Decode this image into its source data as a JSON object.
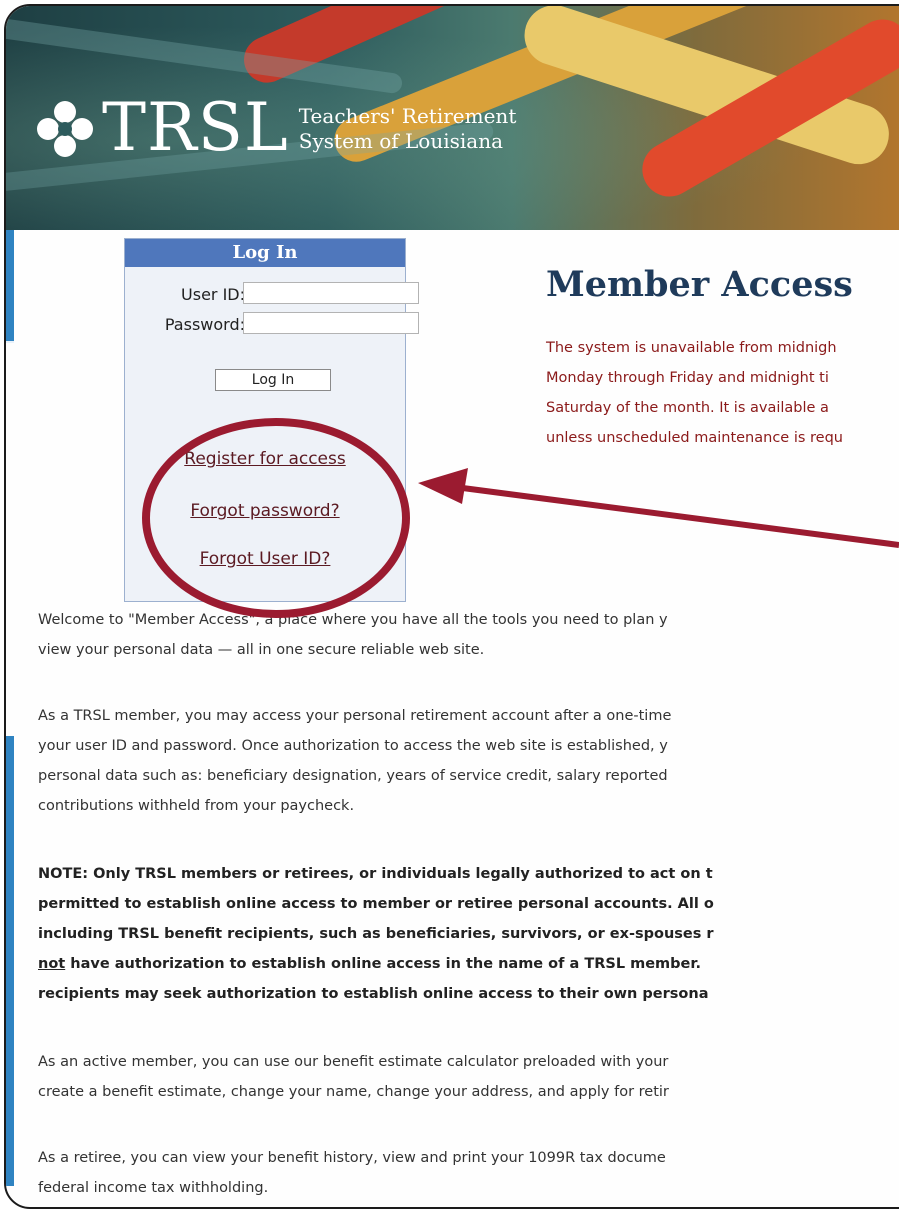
{
  "header": {
    "logo_text": "TRSL",
    "org_line1": "Teachers' Retirement",
    "org_line2": "System of Louisiana"
  },
  "login": {
    "title": "Log In",
    "user_id_label": "User ID:",
    "user_id_value": "",
    "password_label": "Password:",
    "password_value": "",
    "button_label": "Log In",
    "links": [
      "Register for access",
      "Forgot password?",
      "Forgot User ID?"
    ]
  },
  "main": {
    "heading": "Member Access",
    "notice_lines": [
      "The system is unavailable from midnigh",
      "Monday through Friday and midnight ti",
      "Saturday of the month. It is available a",
      "unless unscheduled maintenance is requ"
    ],
    "welcome_lines": [
      "Welcome to \"Member Access\", a place where you have all the tools you need to plan y",
      "view your personal data — all in one secure reliable web site."
    ],
    "member_lines": [
      "As a TRSL member, you may access your personal retirement account after a one-time",
      "your user ID and password. Once authorization to access the web site is established, y",
      "personal data such as: beneficiary designation, years of service credit, salary reported",
      "contributions withheld from your paycheck."
    ],
    "note_lines": [
      "NOTE: Only TRSL members or retirees, or individuals legally authorized to act on t",
      "permitted to establish online access to member or retiree personal accounts. All o",
      "including TRSL benefit recipients, such as beneficiaries, survivors, or ex-spouses r",
      "recipients may seek authorization to establish online access to their own persona"
    ],
    "note_line4_underlined": "not",
    "note_line4_rest": " have authorization to establish online access in the name of a TRSL member.",
    "active_lines": [
      "As an active member, you can use our benefit estimate calculator preloaded with your",
      "create a benefit estimate, change your name, change your address, and apply for retir"
    ],
    "retiree_lines": [
      "As a retiree, you can view your benefit history, view and print your 1099R tax docume",
      "federal income tax withholding."
    ]
  },
  "colors": {
    "login_header": "#4f77bc",
    "login_bg": "#eef2f8",
    "heading": "#1f3b5b",
    "notice_text": "#8b1a1a",
    "callout": "#9b1b30",
    "side_strip": "#2f83c1"
  },
  "icons": {
    "logo": "trsl-logo-icon"
  }
}
